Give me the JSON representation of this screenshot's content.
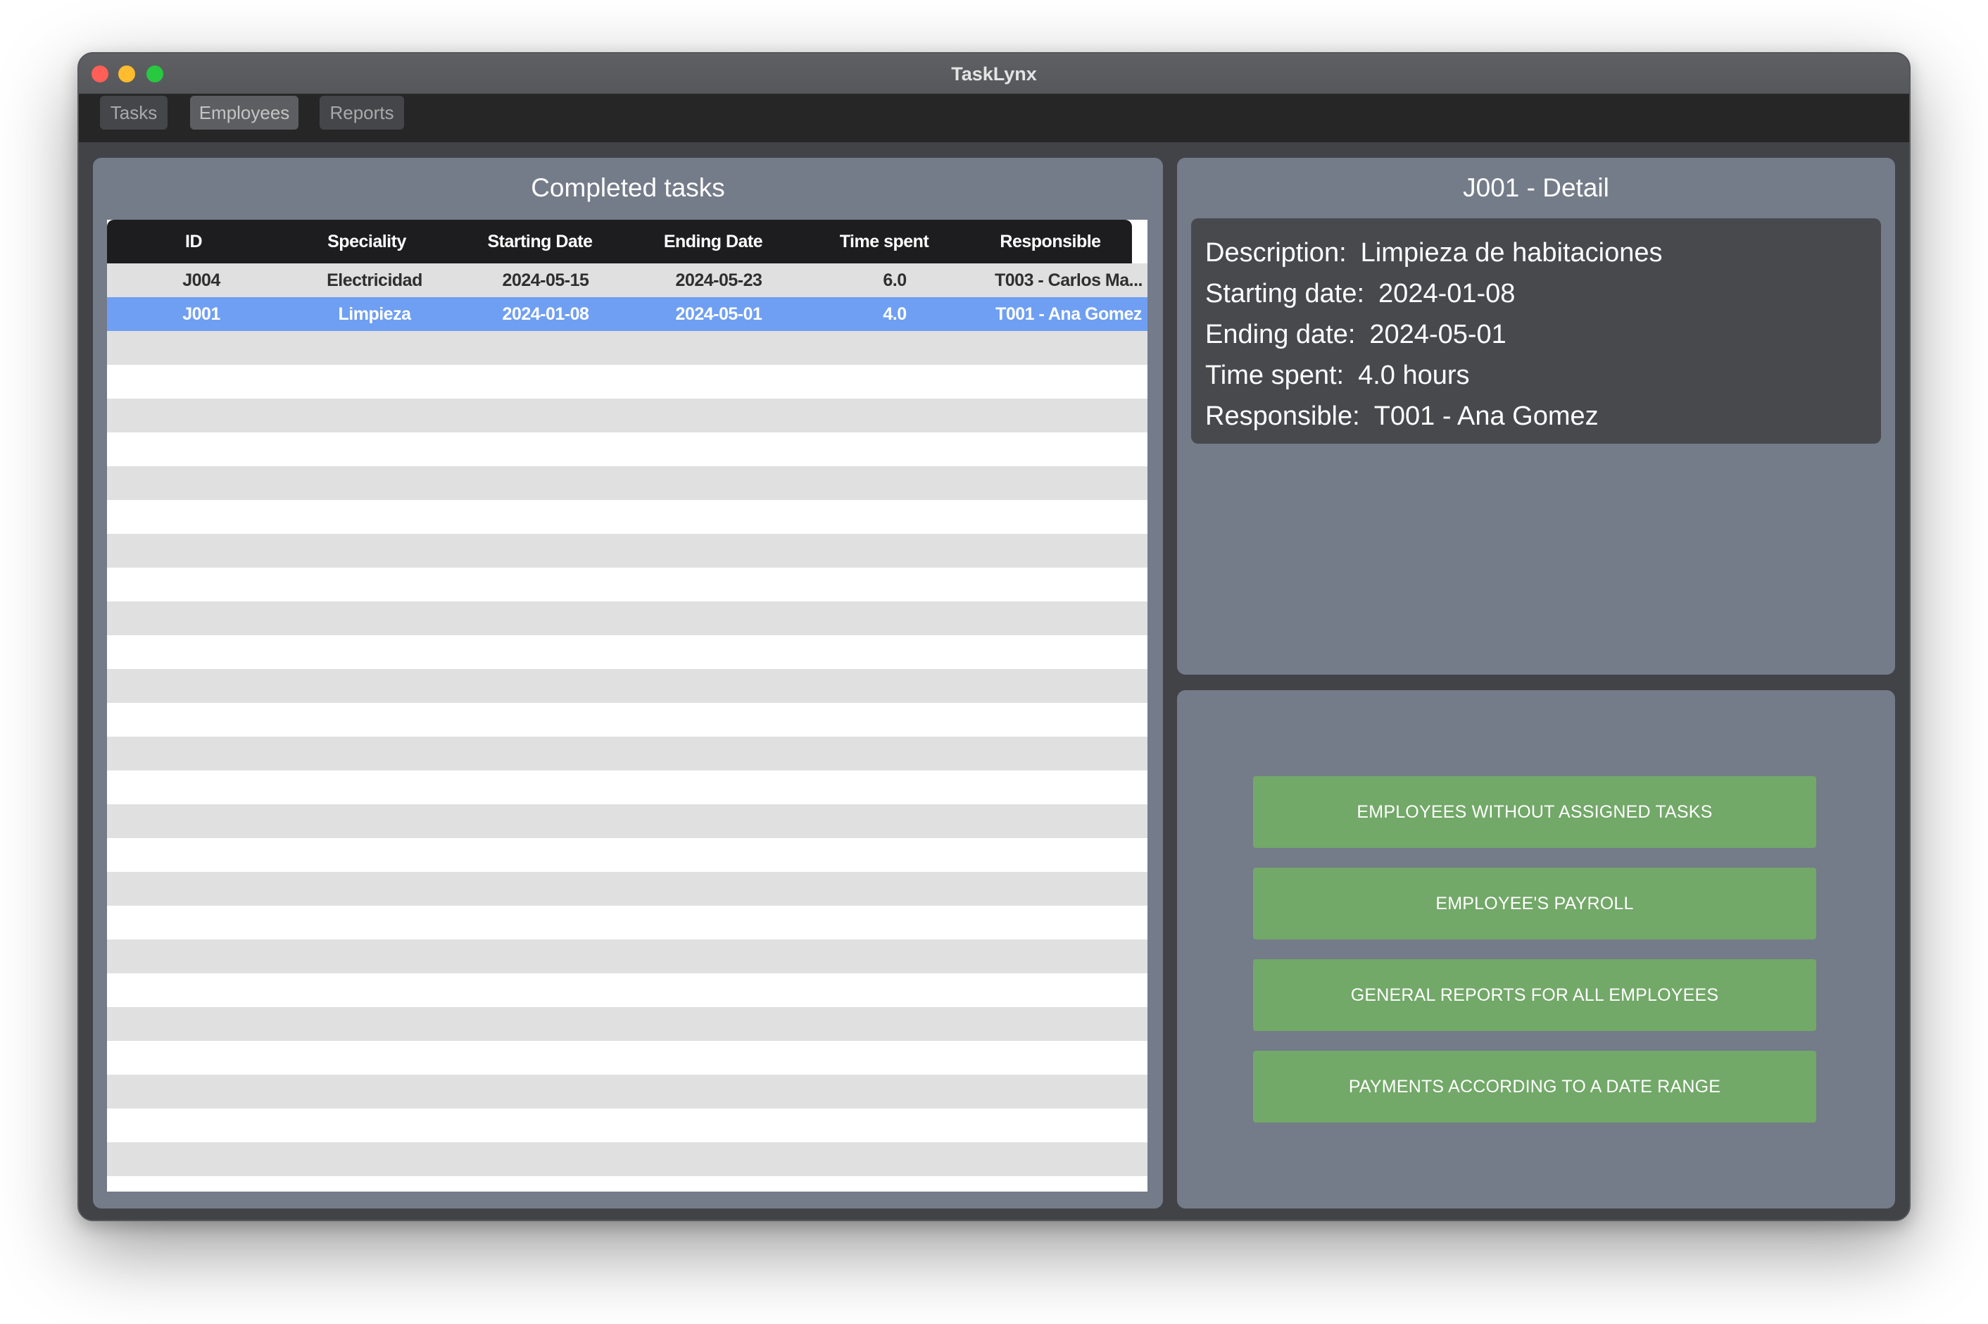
{
  "window": {
    "title": "TaskLynx"
  },
  "menu": [
    {
      "label": "Tasks",
      "active": false
    },
    {
      "label": "Employees",
      "active": true
    },
    {
      "label": "Reports",
      "active": false
    }
  ],
  "tasks_panel": {
    "title": "Completed tasks",
    "columns": [
      "ID",
      "Speciality",
      "Starting Date",
      "Ending Date",
      "Time spent",
      "Responsible"
    ],
    "rows": [
      {
        "id": "J004",
        "speciality": "Electricidad",
        "start": "2024-05-15",
        "end": "2024-05-23",
        "time": "6.0",
        "responsible": "T003 - Carlos Ma...",
        "selected": false
      },
      {
        "id": "J001",
        "speciality": "Limpieza",
        "start": "2024-01-08",
        "end": "2024-05-01",
        "time": "4.0",
        "responsible": "T001 - Ana Gomez",
        "selected": true
      }
    ]
  },
  "detail_panel": {
    "title": "J001 - Detail",
    "fields": [
      {
        "label": "Description:",
        "value": "Limpieza de habitaciones"
      },
      {
        "label": "Starting date:",
        "value": "2024-01-08"
      },
      {
        "label": "Ending date:",
        "value": "2024-05-01"
      },
      {
        "label": "Time spent:",
        "value": "4.0 hours"
      },
      {
        "label": "Responsible:",
        "value": "T001 - Ana Gomez"
      }
    ]
  },
  "reports": {
    "buttons": [
      "EMPLOYEES WITHOUT ASSIGNED TASKS",
      "EMPLOYEE'S PAYROLL",
      "GENERAL REPORTS FOR ALL EMPLOYEES",
      "PAYMENTS ACCORDING TO A DATE RANGE"
    ]
  },
  "colors": {
    "panel": "#747b89",
    "selected_row": "#6f9ff2",
    "report_button": "#72a868",
    "header": "#1d1d1f"
  }
}
